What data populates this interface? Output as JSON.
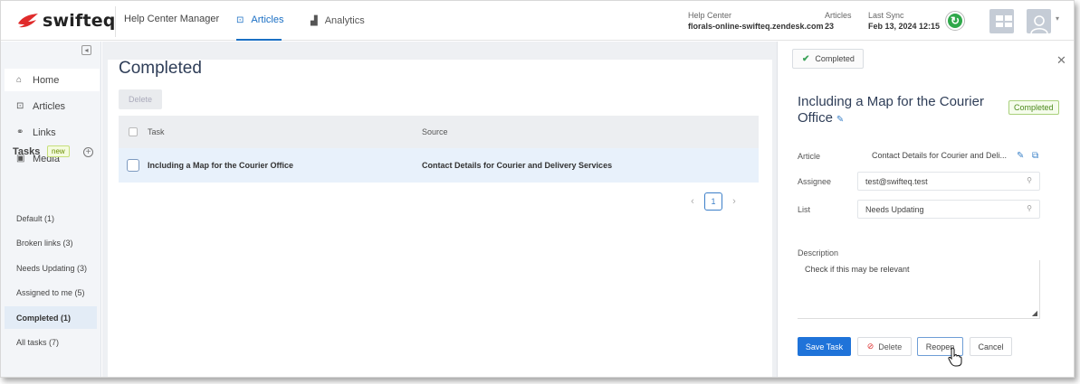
{
  "header": {
    "logo_text": "swifteq",
    "app_title": "Help Center Manager",
    "tabs": [
      {
        "label": "Articles",
        "icon": "articles-icon"
      },
      {
        "label": "Analytics",
        "icon": "analytics-icon"
      }
    ],
    "help_center_label": "Help Center",
    "help_center_value": "florals-online-swifteq.zendesk.com",
    "articles_label": "Articles",
    "articles_value": "23",
    "last_sync_label": "Last Sync",
    "last_sync_value": "Feb 13, 2024 12:15"
  },
  "sidebar": {
    "items": [
      {
        "label": "Home",
        "icon": "home-icon"
      },
      {
        "label": "Articles",
        "icon": "article-icon"
      },
      {
        "label": "Links",
        "icon": "link-icon"
      },
      {
        "label": "Media",
        "icon": "media-icon"
      }
    ],
    "tasks_label": "Tasks",
    "new_badge": "new",
    "task_lists": [
      "Default (1)",
      "Broken links (3)",
      "Needs Updating (3)",
      "Assigned to me (5)",
      "Completed (1)",
      "All tasks (7)"
    ]
  },
  "main": {
    "title": "Completed",
    "delete_label": "Delete",
    "columns": [
      "Task",
      "Source"
    ],
    "rows": [
      {
        "task": "Including a Map for the Courier Office",
        "source": "Contact Details for Courier and Delivery Services"
      }
    ],
    "page": "1"
  },
  "panel": {
    "status_chip": "Completed",
    "title": "Including a Map for the Courier Office",
    "status_badge": "Completed",
    "article_label": "Article",
    "article_value": "Contact Details for Courier and Deli...",
    "assignee_label": "Assignee",
    "assignee_value": "test@swifteq.test",
    "list_label": "List",
    "list_value": "Needs Updating",
    "description_label": "Description",
    "description_value": "Check if this may be relevant",
    "buttons": {
      "save": "Save Task",
      "delete": "Delete",
      "reopen": "Reopen",
      "cancel": "Cancel"
    }
  },
  "colors": {
    "accent": "#1f73d9",
    "brand_red": "#e02b2b",
    "sync_green": "#2fa84a"
  }
}
